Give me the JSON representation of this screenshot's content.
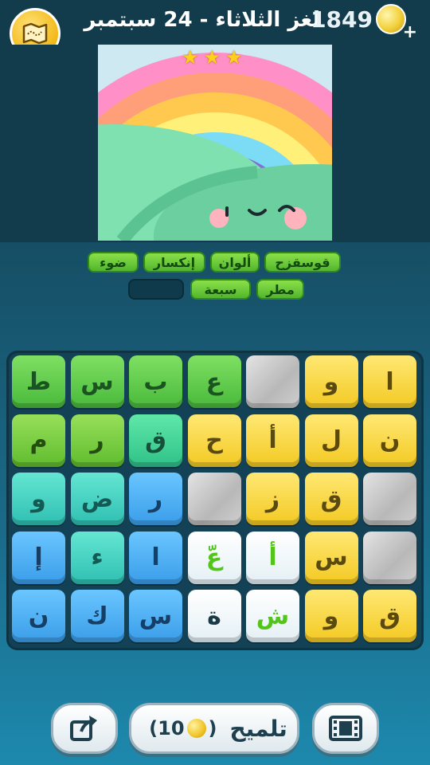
{
  "header": {
    "title": "لغز الثلاثاء - 24 سبتمبر",
    "coins": "1849",
    "plus": "+"
  },
  "stars": [
    "★",
    "★",
    "★"
  ],
  "words": [
    {
      "text": "قوسقزح",
      "found": true
    },
    {
      "text": "ألوان",
      "found": true
    },
    {
      "text": "إنكسار",
      "found": true
    },
    {
      "text": "ضوء",
      "found": true
    },
    {
      "text": "مطر",
      "found": true
    },
    {
      "text": "سبعة",
      "found": true
    },
    {
      "text": "",
      "found": false
    }
  ],
  "board": {
    "columns": 7,
    "rows": 5,
    "cells": [
      [
        "ا",
        "و",
        "",
        "ع",
        "ب",
        "س",
        "ط"
      ],
      [
        "ن",
        "ل",
        "أ",
        "ح",
        "ق",
        "ر",
        "م"
      ],
      [
        "",
        "ق",
        "ز",
        "",
        "ر",
        "ض",
        "و"
      ],
      [
        "",
        "س",
        "أ",
        "عّ",
        "ا",
        "ء",
        "إ"
      ],
      [
        "ق",
        "و",
        "ش",
        "ة",
        "س",
        "ك",
        "ن"
      ]
    ],
    "colors": [
      [
        "yellow",
        "yellow",
        "stone",
        "green",
        "green",
        "green",
        "green"
      ],
      [
        "yellow",
        "yellow",
        "yellow",
        "yellow",
        "mint",
        "lime",
        "lime"
      ],
      [
        "stone",
        "yellow",
        "yellow",
        "stone",
        "blue",
        "teal",
        "teal"
      ],
      [
        "stone",
        "yellow",
        "white",
        "white",
        "blue",
        "teal",
        "blue"
      ],
      [
        "yellow",
        "yellow",
        "white",
        "white-dark",
        "blue",
        "blue",
        "blue"
      ]
    ]
  },
  "buttons": {
    "hint_label": "تلميح",
    "hint_cost_open": "(",
    "hint_cost_value": "10",
    "hint_cost_close": ")"
  }
}
